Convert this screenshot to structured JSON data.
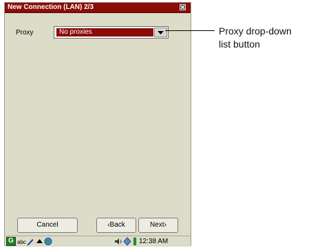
{
  "window": {
    "title": "New Connection (LAN) 2/3",
    "close_icon": "close-icon"
  },
  "form": {
    "proxy_label": "Proxy",
    "proxy_value": "No proxies",
    "dropdown_icon": "chevron-down-icon"
  },
  "buttons": {
    "cancel": "Cancel",
    "back": "‹Back",
    "next": "Next›"
  },
  "taskbar": {
    "start_glyph": "G",
    "input_mode": "abc",
    "clock": "12:38 AM",
    "icons": [
      "start-icon",
      "pen-icon",
      "up-arrow-icon",
      "globe-icon",
      "speaker-icon",
      "network-icon",
      "battery-icon"
    ]
  },
  "annotation": {
    "line1": "Proxy drop-down",
    "line2": "list button"
  },
  "colors": {
    "title_bar": "#8a0d08",
    "selection": "#8a0d08",
    "background": "#dcdcc8",
    "battery": "#2aa832"
  }
}
